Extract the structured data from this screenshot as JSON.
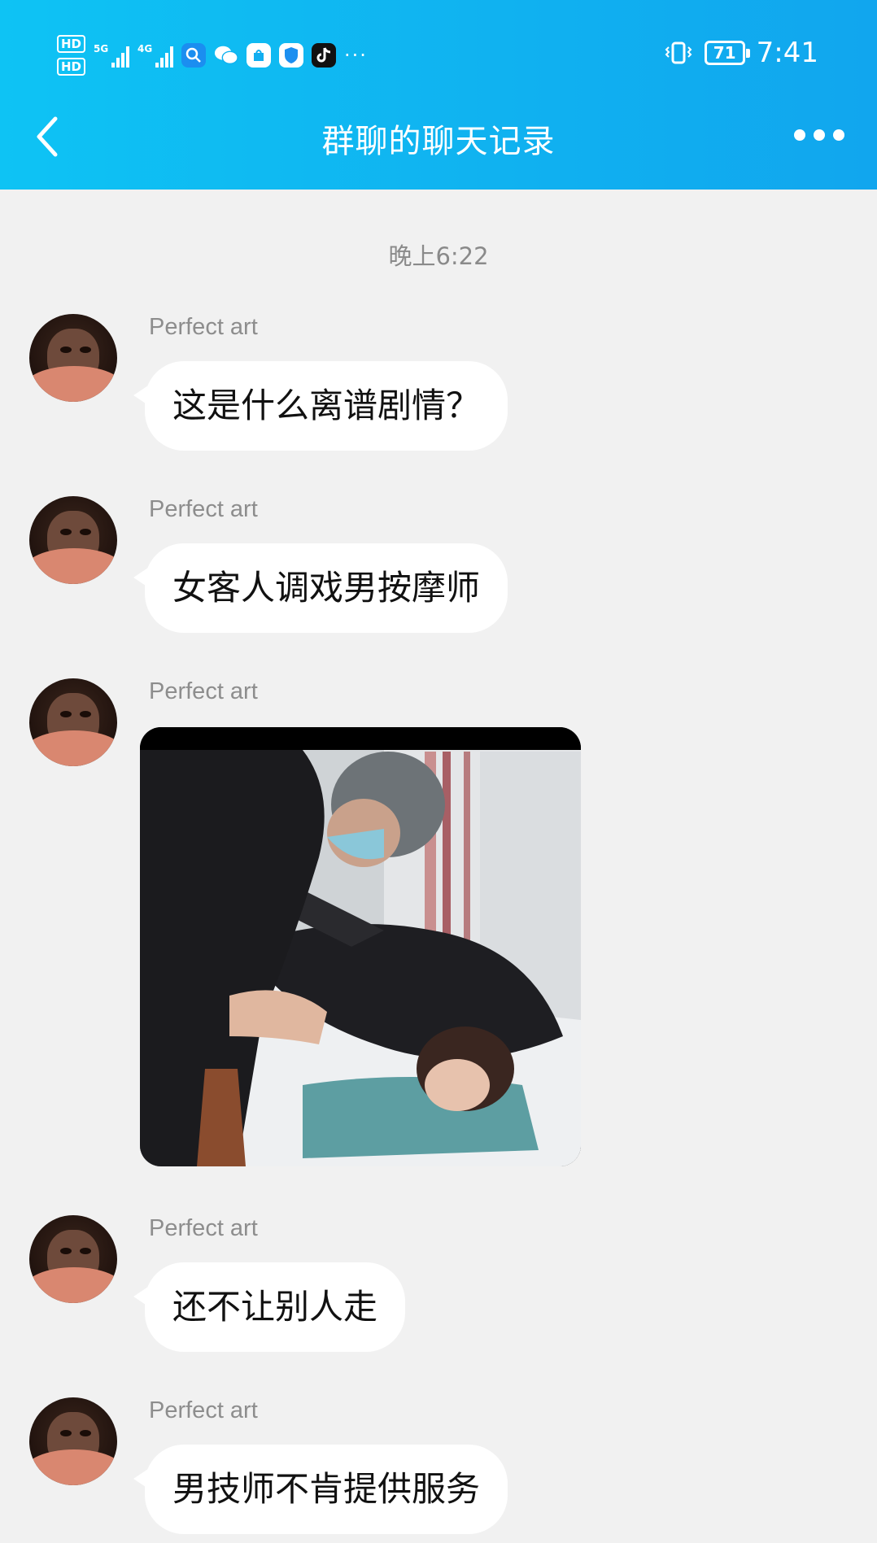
{
  "status_bar": {
    "hd1": "HD",
    "hd2": "HD",
    "net1": "5G",
    "net2": "4G",
    "more": "···",
    "battery": "71",
    "time": "7:41"
  },
  "header": {
    "title": "群聊的聊天记录"
  },
  "chat": {
    "timestamp": "晚上6:22",
    "messages": [
      {
        "sender": "Perfect art",
        "text": "这是什么离谱剧情？"
      },
      {
        "sender": "Perfect art",
        "text": "女客人调戏男按摩师"
      },
      {
        "sender": "Perfect art",
        "type": "image"
      },
      {
        "sender": "Perfect art",
        "text": "还不让别人走"
      },
      {
        "sender": "Perfect art",
        "text": "男技师不肯提供服务"
      }
    ]
  },
  "colors": {
    "header_gradient_start": "#0ec3f4",
    "header_gradient_end": "#11a6ee",
    "background": "#f1f1f1",
    "bubble": "#ffffff"
  }
}
